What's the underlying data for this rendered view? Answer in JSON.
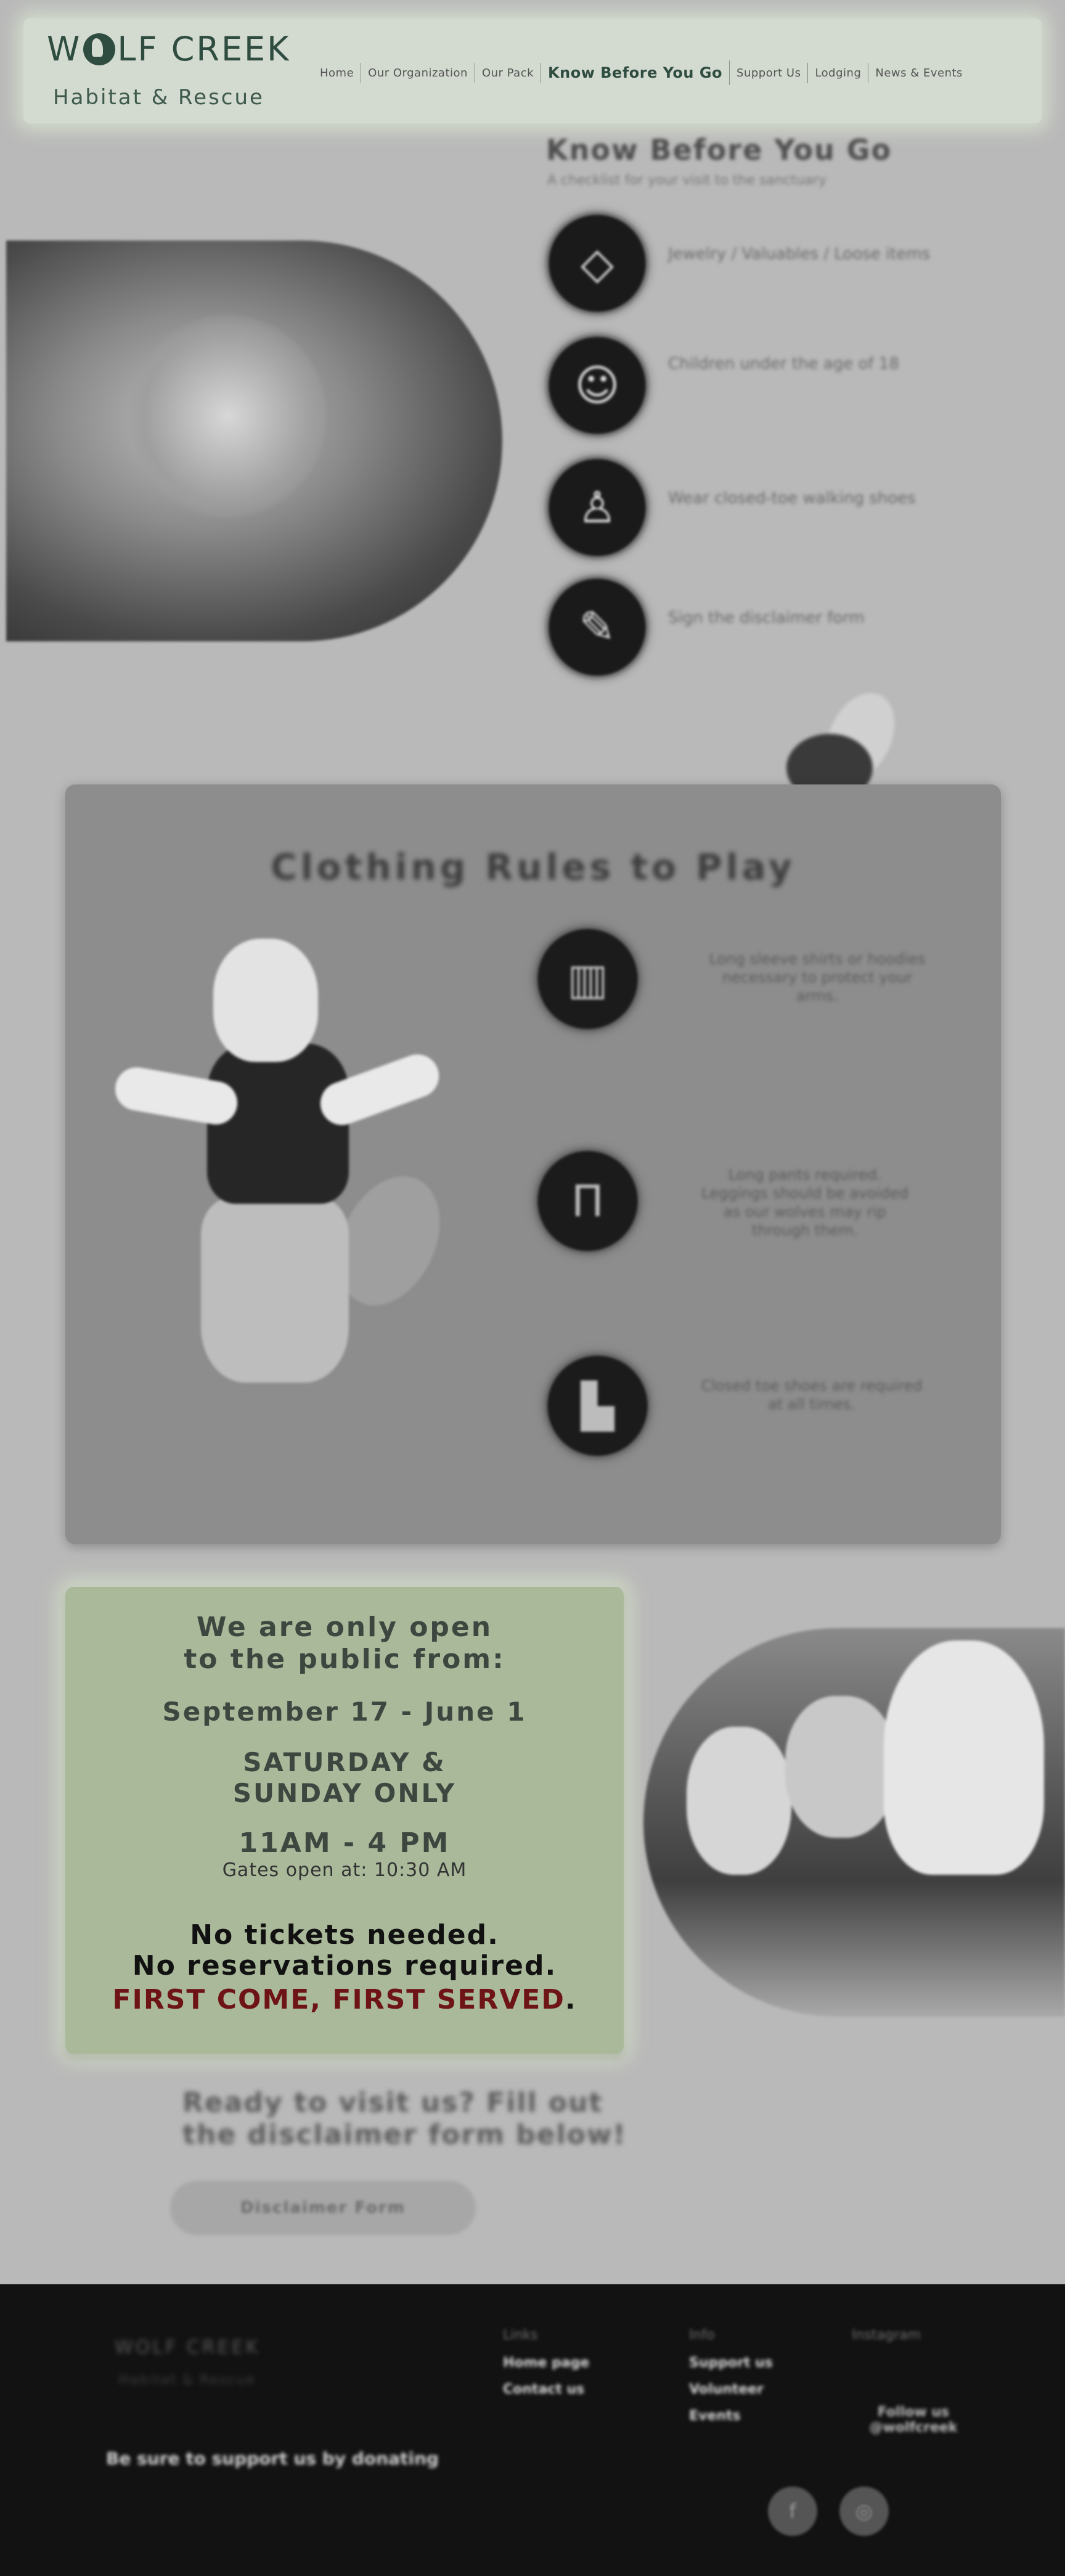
{
  "header": {
    "logo_main_before": "W",
    "logo_main_after": "LF CREEK",
    "logo_sub": "Habitat & Rescue",
    "nav": [
      {
        "label": "Home"
      },
      {
        "label": "Our Organization"
      },
      {
        "label": "Our Pack"
      },
      {
        "label": "Know Before You Go",
        "active": true
      },
      {
        "label": "Support Us"
      },
      {
        "label": "Lodging"
      },
      {
        "label": "News & Events"
      }
    ]
  },
  "know_before": {
    "title": "Know Before You Go",
    "subtitle": "A checklist for your visit to the sanctuary",
    "items": [
      {
        "icon": "diamond-icon",
        "text": "Jewelry / Valuables / Loose items"
      },
      {
        "icon": "child-icon",
        "text": "Children under the age of 18"
      },
      {
        "icon": "hiker-icon",
        "text": "Wear closed-toe walking shoes"
      },
      {
        "icon": "form-icon",
        "text": "Sign the disclaimer form"
      }
    ]
  },
  "clothing": {
    "title": "Clothing Rules to Play",
    "items": [
      {
        "icon": "shirt-icon",
        "text": "Long sleeve shirts or hoodies necessary to protect your arms."
      },
      {
        "icon": "pants-icon",
        "text": "Long pants required. Leggings should be avoided as our wolves may rip through them."
      },
      {
        "icon": "shoe-icon",
        "text": "Closed toe shoes are required at all times."
      }
    ]
  },
  "open_info": {
    "open_line": "We are only open to the public from:",
    "dates": "September 17 - June 1",
    "days": "SATURDAY & SUNDAY ONLY",
    "hours": "11AM - 4 PM",
    "gates": "Gates open at: 10:30 AM",
    "tickets_1": "No tickets needed.",
    "tickets_2": "No reservations required.",
    "first_come": "FIRST COME, FIRST SERVED",
    "first_come_punct": ".",
    "accent_color": "#6e1416",
    "card_color": "#a9b99a"
  },
  "cta": {
    "ready_text": "Ready to visit us? Fill out the disclaimer form below!",
    "button_label": "Disclaimer Form"
  },
  "footer": {
    "logo": "WOLF CREEK",
    "logo_sub": "Habitat & Rescue",
    "tagline": "Be sure to support us by donating",
    "col1_heading": "Links",
    "col1_links": [
      "Home page",
      "Contact us"
    ],
    "col2_heading": "Info",
    "col2_links": [
      "Support us",
      "Volunteer",
      "Events"
    ],
    "col3_heading": "Instagram",
    "col3_text": "Follow us @wolfcreek",
    "social": [
      {
        "icon": "facebook-icon"
      },
      {
        "icon": "instagram-icon"
      }
    ]
  }
}
